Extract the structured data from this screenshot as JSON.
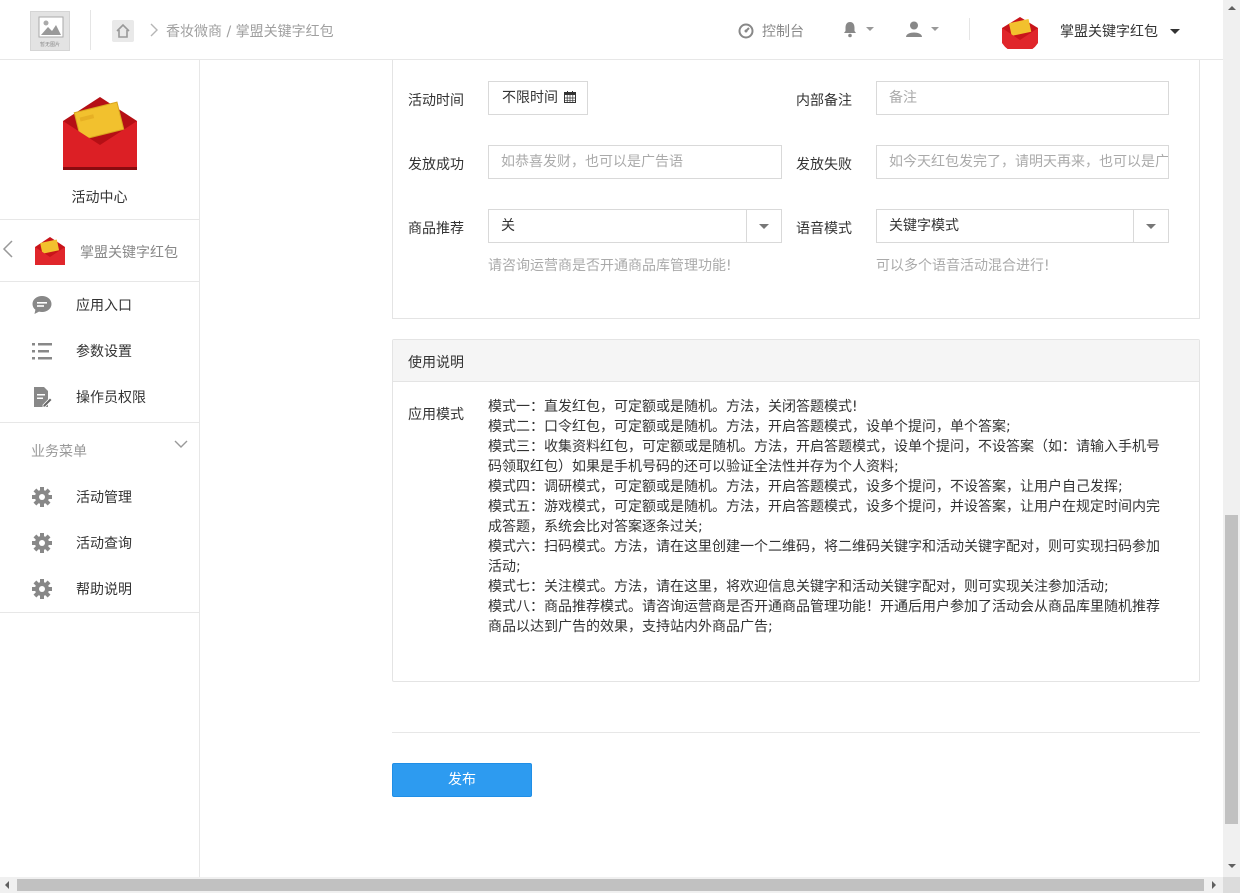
{
  "header": {
    "logo_text": "暂无图片",
    "breadcrumb": "香妆微商 / 掌盟关键字红包",
    "console_label": "控制台",
    "app_name": "掌盟关键字红包"
  },
  "sidebar": {
    "hero_title": "活动中心",
    "current_app": "掌盟关键字红包",
    "items": [
      {
        "label": "应用入口",
        "icon": "chat-bubble-icon"
      },
      {
        "label": "参数设置",
        "icon": "list-icon"
      },
      {
        "label": "操作员权限",
        "icon": "edit-doc-icon"
      }
    ],
    "group_label": "业务菜单",
    "group_items": [
      {
        "label": "活动管理",
        "icon": "gear-icon"
      },
      {
        "label": "活动查询",
        "icon": "gear-icon"
      },
      {
        "label": "帮助说明",
        "icon": "gear-icon"
      }
    ]
  },
  "form": {
    "activity_time_label": "活动时间",
    "activity_time_value": "不限时间",
    "note_label": "内部备注",
    "note_placeholder": "备注",
    "success_label": "发放成功",
    "success_placeholder": "如恭喜发财，也可以是广告语",
    "fail_label": "发放失败",
    "fail_placeholder": "如今天红包发完了，请明天再来，也可以是广告语",
    "product_label": "商品推荐",
    "product_value": "关",
    "product_hint": "请咨询运营商是否开通商品库管理功能!",
    "voice_label": "语音模式",
    "voice_value": "关键字模式",
    "voice_hint": "可以多个语音活动混合进行!"
  },
  "usage": {
    "title": "使用说明",
    "label": "应用模式",
    "lines": [
      "模式一：直发红包，可定额或是随机。方法，关闭答题模式!",
      "模式二：口令红包，可定额或是随机。方法，开启答题模式，设单个提问，单个答案;",
      "模式三：收集资料红包，可定额或是随机。方法，开启答题模式，设单个提问，不设答案（如：请输入手机号码领取红包）如果是手机号码的还可以验证全法性并存为个人资料;",
      "模式四：调研模式，可定额或是随机。方法，开启答题模式，设多个提问，不设答案，让用户自己发挥;",
      "模式五：游戏模式，可定额或是随机。方法，开启答题模式，设多个提问，并设答案，让用户在规定时间内完成答题，系统会比对答案逐条过关;",
      "模式六：扫码模式。方法，请在这里创建一个二维码，将二维码关键字和活动关键字配对，则可实现扫码参加活动;",
      "模式七：关注模式。方法，请在这里，将欢迎信息关键字和活动关键字配对，则可实现关注参加活动;",
      "模式八：商品推荐模式。请咨询运营商是否开通商品管理功能！开通后用户参加了活动会从商品库里随机推荐商品以达到广告的效果，支持站内外商品广告;"
    ]
  },
  "actions": {
    "publish_label": "发布"
  },
  "colors": {
    "primary": "#2d9bf0",
    "envelope_red": "#d3161b",
    "card_gold": "#f2c12e"
  }
}
